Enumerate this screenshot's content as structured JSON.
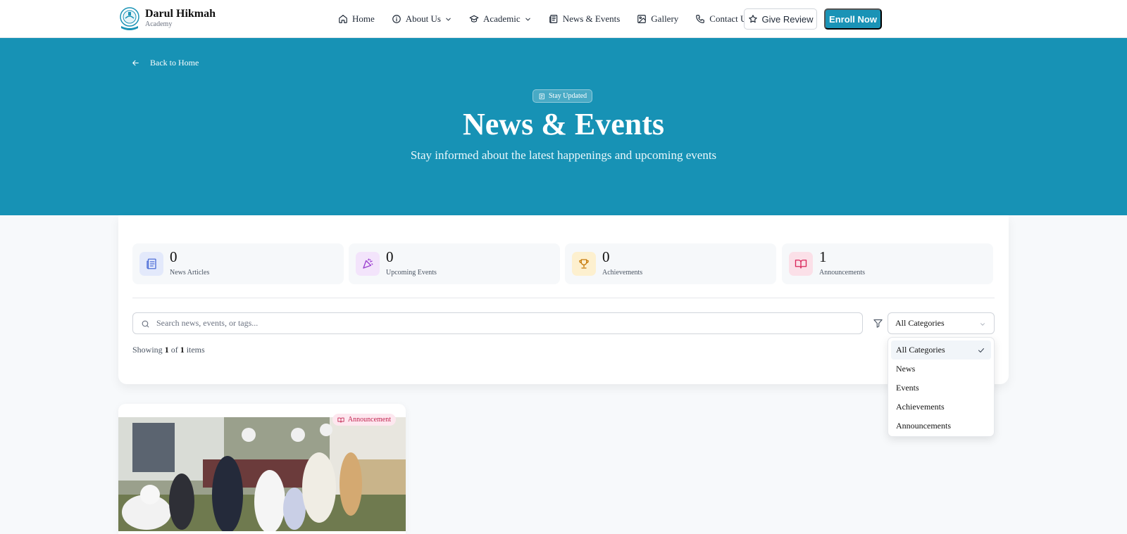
{
  "brand": {
    "name": "Darul Hikmah",
    "subtitle": "Academy"
  },
  "nav": {
    "home": "Home",
    "about": "About Us",
    "academic": "Academic",
    "news": "News & Events",
    "gallery": "Gallery",
    "contact": "Contact Us",
    "review_button": "Give Review",
    "enroll_button": "Enroll Now"
  },
  "hero": {
    "back_link": "Back to Home",
    "badge": "Stay Updated",
    "title": "News & Events",
    "subtitle": "Stay informed about the latest happenings and upcoming events"
  },
  "stats": [
    {
      "value": "0",
      "label": "News Articles",
      "icon": "newspaper-icon",
      "color": "#4f6fd8"
    },
    {
      "value": "0",
      "label": "Upcoming Events",
      "icon": "party-popper-icon",
      "color": "#9b3fcf"
    },
    {
      "value": "0",
      "label": "Achievements",
      "icon": "trophy-icon",
      "color": "#c77a0a"
    },
    {
      "value": "1",
      "label": "Announcements",
      "icon": "book-open-icon",
      "color": "#d9265a"
    }
  ],
  "search": {
    "placeholder": "Search news, events, or tags..."
  },
  "filter": {
    "selected": "All Categories",
    "options": [
      "All Categories",
      "News",
      "Events",
      "Achievements",
      "Announcements"
    ]
  },
  "results": {
    "prefix": "Showing",
    "shown": "1",
    "of": "of",
    "total": "1",
    "suffix": "items"
  },
  "news_items": [
    {
      "tag": "Announcement"
    }
  ],
  "colors": {
    "primary": "#1792b5",
    "button": "#1a93b6",
    "tag_bg": "#fde7ef",
    "tag_text": "#c0224d"
  }
}
